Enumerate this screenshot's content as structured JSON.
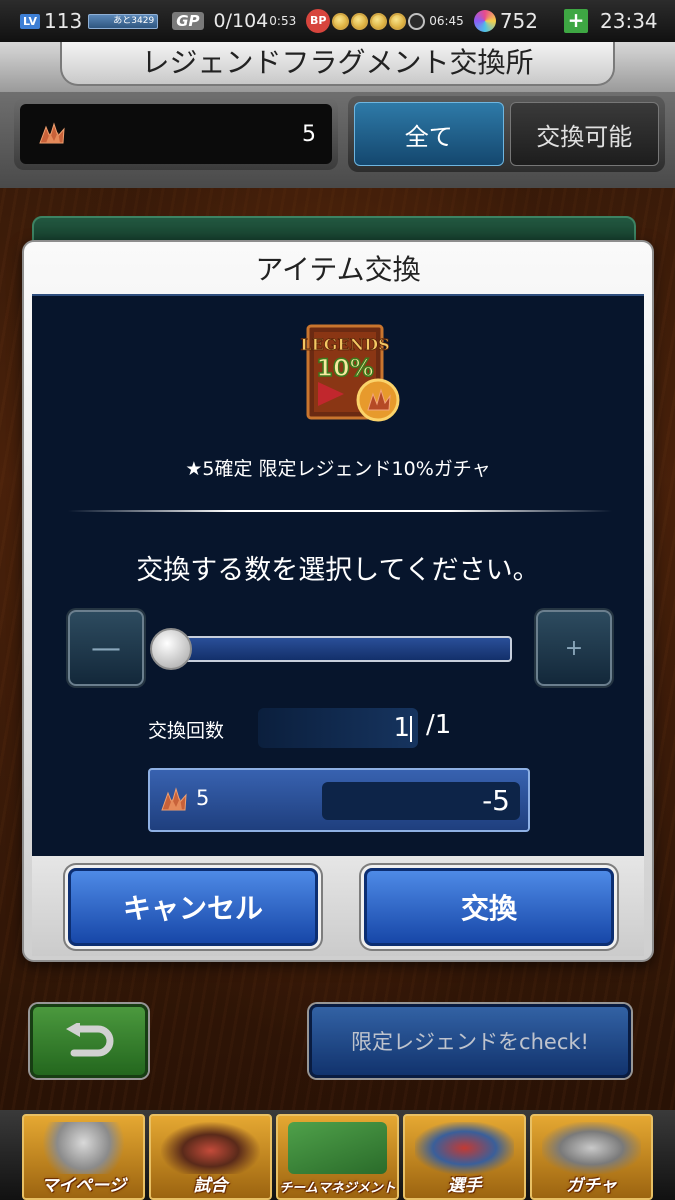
{
  "status_bar": {
    "level_label": "LV",
    "level": "113",
    "exp_text": "あと3429",
    "gp_label": "GP",
    "gp_value": "0/104",
    "gp_timer": "0:53",
    "bp_label": "BP",
    "bp_filled": 4,
    "bp_total": 5,
    "bp_timer": "06:45",
    "gems": "752",
    "clock": "23:34"
  },
  "header": {
    "title": "レジェンドフラグメント交換所"
  },
  "filter": {
    "fragment_count": "5",
    "tabs": [
      {
        "label": "全て",
        "active": true
      },
      {
        "label": "交換可能",
        "active": false
      }
    ]
  },
  "modal": {
    "title": "アイテム交換",
    "item_image_text": "LEGENDS 10%",
    "item_name": "★5確定 限定レジェンド10%ガチャ",
    "prompt": "交換する数を選択してください。",
    "minus_label": "—",
    "plus_label": "+",
    "slider_fraction": 0,
    "count_label": "交換回数",
    "count_value": "1",
    "count_max": "/1",
    "cost_have": "5",
    "cost_value": "-5",
    "cancel_label": "キャンセル",
    "confirm_label": "交換"
  },
  "bottom": {
    "check_label": "限定レジェンドをcheck!"
  },
  "tabbar": {
    "items": [
      {
        "label": "マイページ"
      },
      {
        "label": "試合"
      },
      {
        "label": "チームマネジメント"
      },
      {
        "label": "選手"
      },
      {
        "label": "ガチャ"
      }
    ]
  },
  "colors": {
    "accent_blue": "#1747a8",
    "modal_body": "#07152c",
    "tab_gold": "#e5a832",
    "back_green": "#2c7e25"
  }
}
